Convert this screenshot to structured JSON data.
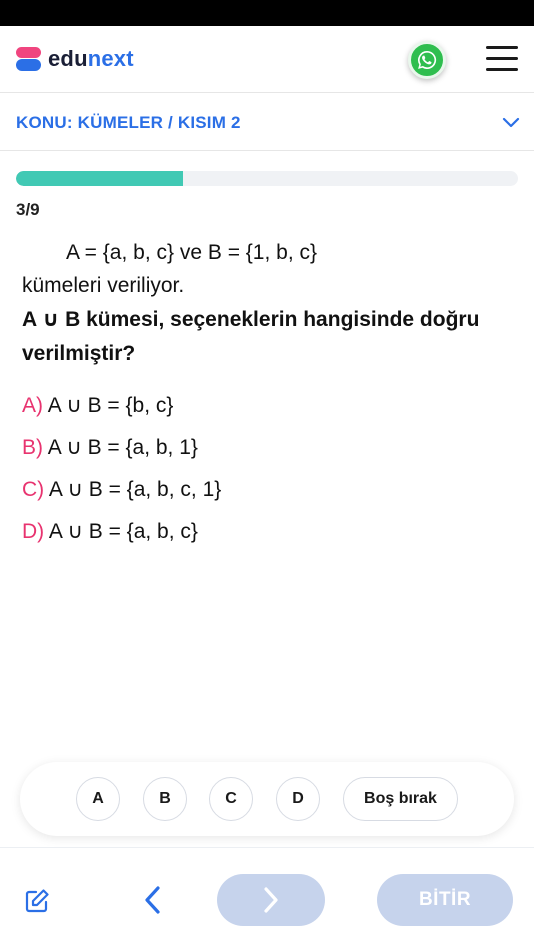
{
  "app": {
    "brand_part1": "edu",
    "brand_part2": "next"
  },
  "header": {
    "whatsapp_icon": "whatsapp-icon",
    "menu_icon": "hamburger-menu-icon"
  },
  "topic": {
    "title": "KONU: KÜMELER / KISIM 2",
    "expand_icon": "chevron-down-icon"
  },
  "progress": {
    "label": "3/9",
    "fraction": 0.333
  },
  "question": {
    "line1": "A = {a, b, c} ve B = {1, b, c}",
    "line2": "kümeleri veriliyor.",
    "line3": "A ∪ B kümesi, seçeneklerin hangisinde doğru verilmiştir?"
  },
  "options": [
    {
      "letter": "A)",
      "text": "A ∪ B = {b, c}"
    },
    {
      "letter": "B)",
      "text": "A ∪ B = {a, b, 1}"
    },
    {
      "letter": "C)",
      "text": "A ∪ B = {a, b, c, 1}"
    },
    {
      "letter": "D)",
      "text": "A ∪ B = {a, b, c}"
    }
  ],
  "answer_buttons": {
    "a": "A",
    "b": "B",
    "c": "C",
    "d": "D",
    "skip": "Boş bırak"
  },
  "bottom": {
    "finish_label": "BİTİR",
    "edit_icon": "edit-icon",
    "prev_icon": "chevron-left-icon",
    "next_icon": "chevron-right-icon"
  },
  "colors": {
    "brand_blue": "#2b6fe6",
    "brand_pink": "#f0457f",
    "progress": "#41c9b4",
    "option_letter": "#e8336f",
    "disabled_button": "#c6d3ec",
    "whatsapp": "#2fbe4f"
  }
}
